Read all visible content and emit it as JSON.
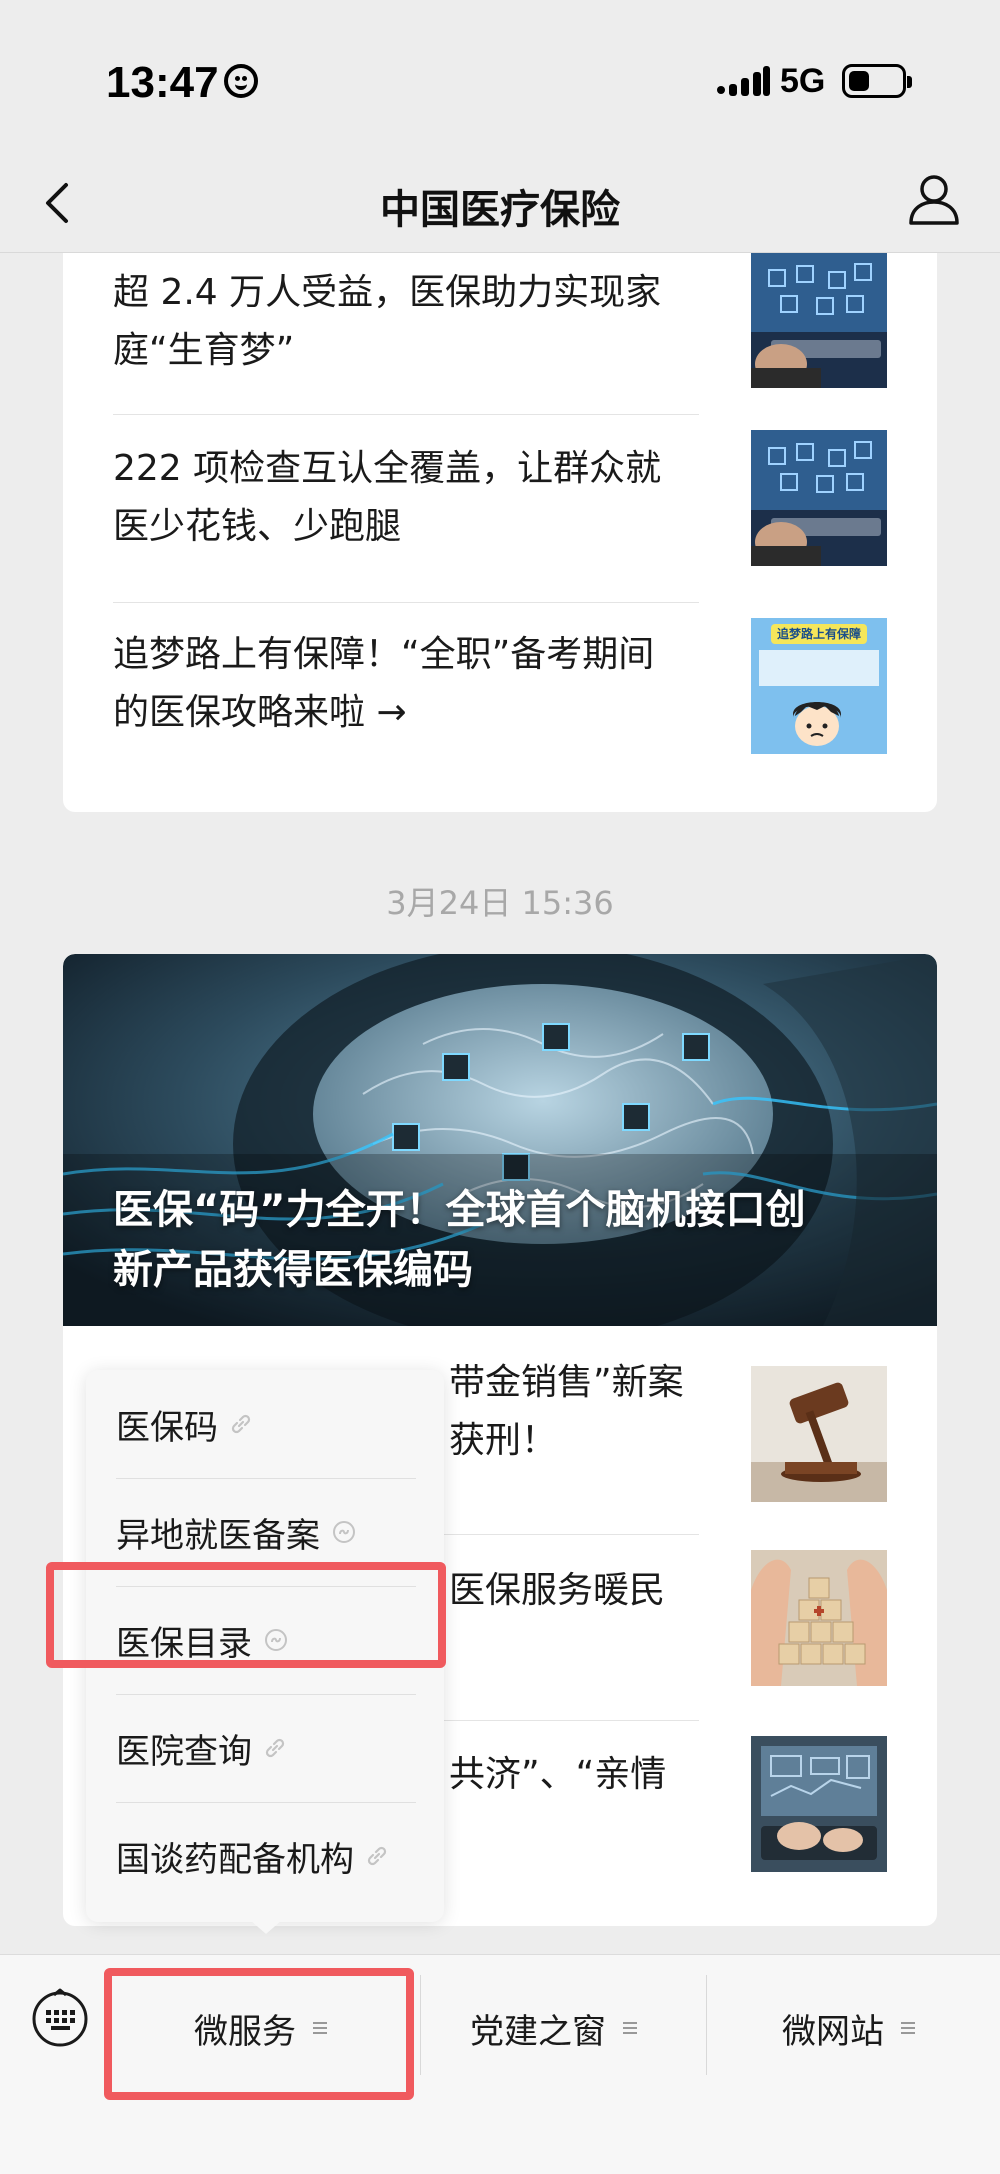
{
  "status_bar": {
    "time": "13:47",
    "network": "5G"
  },
  "nav": {
    "title": "中国医疗保险"
  },
  "feed": {
    "card1_items": [
      {
        "line1": "超 2.4 万人受益，医保助力实现家",
        "line2": "庭“生育梦”"
      },
      {
        "line1": "222 项检查互认全覆盖，让群众就",
        "line2": "医少花钱、少跑腿"
      },
      {
        "line1": "追梦路上有保障！“全职”备考期间",
        "line2": "的医保攻略来啦 →"
      }
    ],
    "thumb3_banner": "追梦路上有保障",
    "timestamp": "3月24日 15:36",
    "hero_title_line1": "医保“码”力全开！全球首个脑机接口创",
    "hero_title_line2": "新产品获得医保编码",
    "card2_items": [
      {
        "line1_partial": "带金销售”新案",
        "line2_partial": "获刑！"
      },
      {
        "line1_partial": "医保服务暖民",
        "line2_partial": ""
      },
      {
        "line1_partial": "共济”、“亲情",
        "line2_partial": ""
      }
    ]
  },
  "popup_menu": {
    "items": [
      {
        "label": "医保码"
      },
      {
        "label": "异地就医备案"
      },
      {
        "label": "医保目录"
      },
      {
        "label": "医院查询"
      },
      {
        "label": "国谈药配备机构"
      }
    ]
  },
  "bottom_menu": {
    "tabs": [
      {
        "label": "微服务"
      },
      {
        "label": "党建之窗"
      },
      {
        "label": "微网站"
      }
    ]
  },
  "colors": {
    "highlight": "#f05a5e",
    "background": "#ededed"
  }
}
